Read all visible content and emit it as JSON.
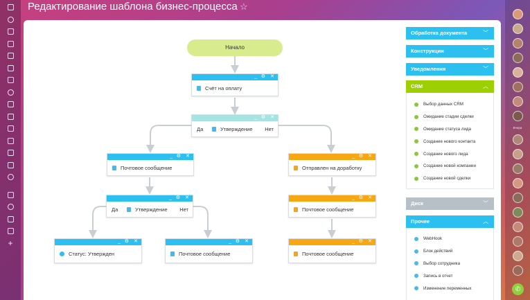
{
  "header": {
    "title": "Редактирование шаблона бизнес-процесса",
    "star_icon": "star-icon"
  },
  "left_nav": {
    "icons": [
      "grid-icon",
      "chat-icon",
      "chart-icon",
      "inbox-icon",
      "robot-icon",
      "code-icon",
      "tag-icon",
      "globe-icon",
      "building-icon",
      "image-icon",
      "document-icon",
      "mail-icon",
      "store-icon",
      "funnel-icon",
      "spotify-icon",
      "sitemap-icon",
      "gear-icon",
      "phone-icon",
      "laptop-icon",
      "plus-icon"
    ]
  },
  "diagram": {
    "start": "Начало",
    "blocks": {
      "invoice": "Счёт на оплату",
      "approve_top": "Утверждение",
      "approve_top_yes": "Да",
      "approve_top_no": "Нет",
      "mail1": "Почтовое сообщение",
      "rework": "Отправлен на доработку",
      "approve_mid": "Утверждение",
      "approve_mid_yes": "Да",
      "approve_mid_no": "Нет",
      "mail_right": "Почтовое сообщение",
      "status": "Статус: Утвержден",
      "mail_mid": "Почтовое сообщение",
      "mail_bottom_right": "Почтовое сообщение"
    },
    "controls": {
      "minimize": "_",
      "settings": "⚙",
      "close": "✕"
    }
  },
  "panel": {
    "sections": [
      {
        "label": "Обработка документа",
        "color": "#2bc0ef"
      },
      {
        "label": "Конструкции",
        "color": "#2bc0ef"
      },
      {
        "label": "Уведомления",
        "color": "#2bc0ef"
      },
      {
        "label": "CRM",
        "color": "#9dcf02"
      },
      {
        "label": "Диск",
        "color": "#b8c0c7"
      },
      {
        "label": "Прочее",
        "color": "#2bc0ef"
      }
    ],
    "crm_items": [
      "Выбор данных CRM",
      "Ожидание стадии сделки",
      "Ожидание статуса лида",
      "Создание нового контакта",
      "Создание нового лида",
      "Создание новой компании",
      "Создание новой сделки"
    ],
    "other_items": [
      "WebHook",
      "Блок действий",
      "Выбор сотрудника",
      "Запись в отчет",
      "Изменение переменных"
    ]
  },
  "right_bar": {
    "label": "Вчера",
    "phone_icon": "phone-icon"
  }
}
